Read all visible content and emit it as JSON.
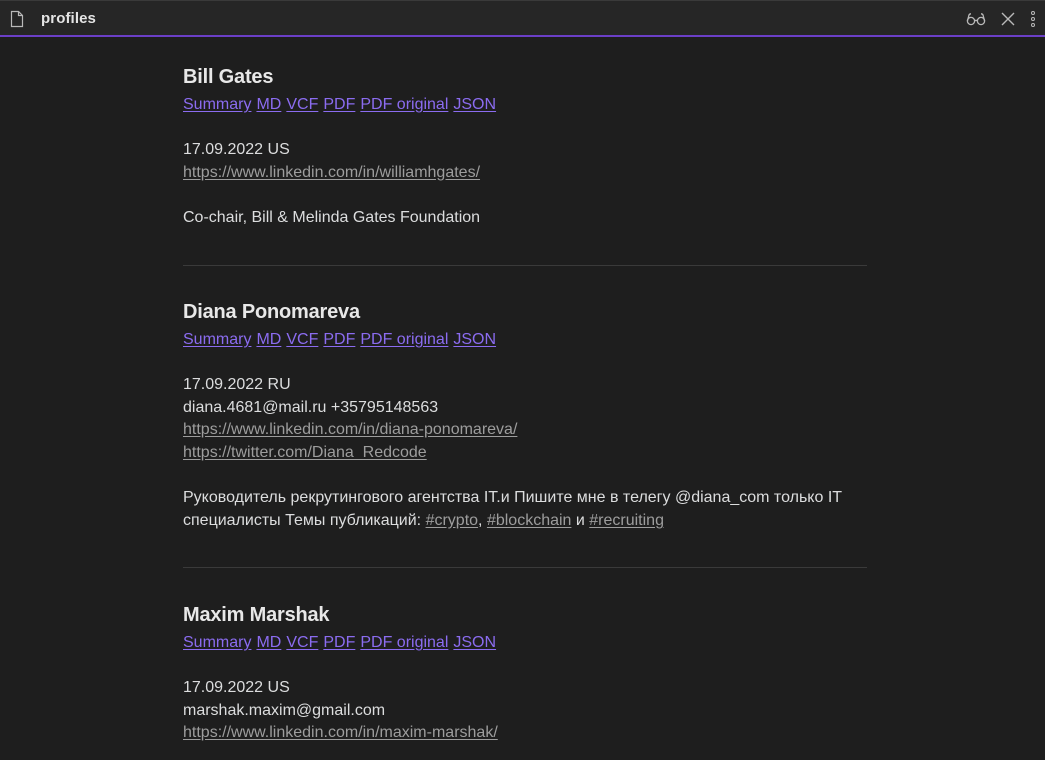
{
  "window": {
    "title": "profiles",
    "file_icon": "file-icon",
    "actions": [
      {
        "icon": "reading-glasses-icon"
      },
      {
        "icon": "close-icon"
      },
      {
        "icon": "more-vertical-icon"
      }
    ]
  },
  "colors": {
    "background": "#1e1e1e",
    "titlebar": "#262626",
    "accent": "#6b3fc7",
    "link": "#8b6cf0",
    "external_link": "#9d9d9d",
    "text": "#dcddde"
  },
  "profiles": [
    {
      "name": "Bill Gates",
      "links": [
        "Summary",
        "MD",
        "VCF",
        "PDF",
        "PDF original",
        "JSON"
      ],
      "date_country": "17.09.2022 US",
      "linkedin": "https://www.linkedin.com/in/williamhgates/",
      "bio": "Co-chair, Bill & Melinda Gates Foundation"
    },
    {
      "name": "Diana Ponomareva",
      "links": [
        "Summary",
        "MD",
        "VCF",
        "PDF",
        "PDF original",
        "JSON"
      ],
      "date_country": "17.09.2022 RU",
      "contact": "diana.4681@mail.ru +35795148563",
      "linkedin": "https://www.linkedin.com/in/diana-ponomareva/",
      "twitter": "https://twitter.com/Diana_Redcode",
      "bio_line1": "Руководитель рекрутингового агентства IT.и Пишите мне в телегу @diana_com только IT",
      "bio_line2_prefix": "специалисты Темы публикаций: ",
      "tags": [
        "#crypto",
        "#blockchain",
        "#recruiting"
      ],
      "tag_sep1": ", ",
      "tag_sep2": " и "
    },
    {
      "name": "Maxim Marshak",
      "links": [
        "Summary",
        "MD",
        "VCF",
        "PDF",
        "PDF original",
        "JSON"
      ],
      "date_country": "17.09.2022 US",
      "contact": "marshak.maxim@gmail.com",
      "linkedin": "https://www.linkedin.com/in/maxim-marshak/"
    }
  ]
}
